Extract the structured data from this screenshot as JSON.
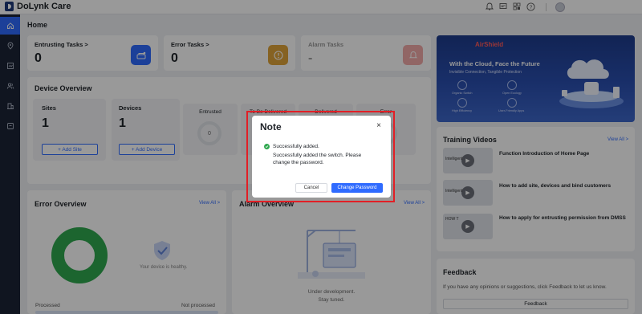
{
  "app": {
    "title": "DoLynk Care"
  },
  "topbar": {
    "icons": [
      "bell-icon",
      "message-icon",
      "grid-icon",
      "help-icon"
    ]
  },
  "sidebar": {
    "items": [
      "home-icon",
      "location-icon",
      "report-icon",
      "users-icon",
      "building-icon",
      "box-icon"
    ]
  },
  "page": {
    "title": "Home"
  },
  "tasks": [
    {
      "title": "Entrusting Tasks",
      "value": "0",
      "arrow": ">"
    },
    {
      "title": "Error Tasks",
      "value": "0",
      "arrow": ">"
    },
    {
      "title": "Alarm Tasks",
      "value": "-",
      "arrow": ""
    }
  ],
  "device_overview": {
    "title": "Device Overview",
    "sites": {
      "label": "Sites",
      "value": "1",
      "button": "+ Add Site"
    },
    "devices": {
      "label": "Devices",
      "value": "1",
      "button": "+ Add Device"
    },
    "statuses": [
      {
        "label": "Entrusted",
        "value": "0"
      },
      {
        "label": "To Be Delivered",
        "value": ""
      },
      {
        "label": "Delivered",
        "value": ""
      },
      {
        "label": "Error",
        "value": ""
      }
    ]
  },
  "banner": {
    "brand": "AirShield",
    "headline": "With the Cloud, Face the Future",
    "sub": "Invisible Connection, Tangible Protection",
    "features": [
      "Organic Switch",
      "Open Ecology",
      "High Efficiency",
      "User-Friendly Apps"
    ]
  },
  "training": {
    "title": "Training Videos",
    "view_all": "View All >",
    "videos": [
      {
        "title": "Function Introduction of Home Page",
        "thumb": "Intelligent"
      },
      {
        "title": "How to add site, devices and bind customers",
        "thumb": "Intelligent"
      },
      {
        "title": "How to apply for entrusting permission from DMSS",
        "thumb": "HOW T"
      }
    ]
  },
  "error_overview": {
    "title": "Error Overview",
    "view_all": "View All >",
    "healthy": "Your device is healthy.",
    "processed": "Processed",
    "not_processed": "Not processed",
    "color": "#2fa84f"
  },
  "alarm_overview": {
    "title": "Alarm Overview",
    "view_all": "View All >",
    "msg1": "Under development.",
    "msg2": "Stay tuned."
  },
  "feedback": {
    "title": "Feedback",
    "text": "If you have any opinions or suggestions, click Feedback to let us know.",
    "button": "Feedback"
  },
  "modal": {
    "title": "Note",
    "close": "×",
    "success": "Successfully added.",
    "message": "Successfully added the switch. Please change the password.",
    "cancel": "Cancel",
    "confirm": "Change Password"
  }
}
